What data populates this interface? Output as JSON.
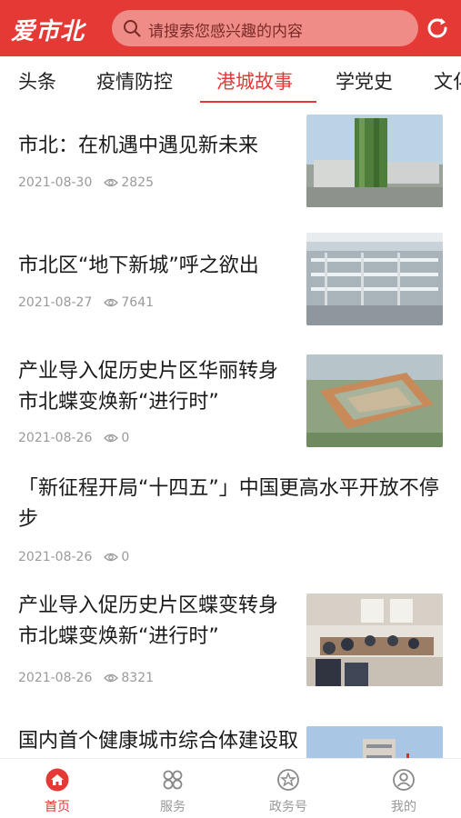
{
  "header": {
    "logo": "爱市北",
    "search_placeholder": "请搜索您感兴趣的内容",
    "brand_color": "#e53935"
  },
  "tabs": [
    {
      "label": "头条",
      "active": false
    },
    {
      "label": "疫情防控",
      "active": false
    },
    {
      "label": "港城故事",
      "active": true
    },
    {
      "label": "学党史",
      "active": false
    },
    {
      "label": "文化",
      "active": false
    }
  ],
  "articles": [
    {
      "title": "市北：在机遇中遇见新未来",
      "date": "2021-08-30",
      "views": "2825",
      "thumb": "green-tower-photo"
    },
    {
      "title": "市北区“地下新城”呼之欲出",
      "date": "2021-08-27",
      "views": "7641",
      "thumb": "underground-construction-photo"
    },
    {
      "title": "产业导入促历史片区华丽转身 市北蝶变焕新“进行时”",
      "date": "2021-08-26",
      "views": "0",
      "thumb": "courtyard-building-photo"
    },
    {
      "title": "「新征程开局“十四五”」中国更高水平开放不停步",
      "date": "2021-08-26",
      "views": "0",
      "thumb": ""
    },
    {
      "title": "产业导入促历史片区蝶变转身 市北蝶变焕新“进行时”",
      "date": "2021-08-26",
      "views": "8321",
      "thumb": "meeting-room-photo"
    },
    {
      "title": "国内首个健康城市综合体建设取得实质进展",
      "date": "",
      "views": "",
      "thumb": "highrise-construction-photo"
    }
  ],
  "bottom_nav": [
    {
      "label": "首页",
      "icon": "home-icon",
      "active": true
    },
    {
      "label": "服务",
      "icon": "services-icon",
      "active": false
    },
    {
      "label": "政务号",
      "icon": "gov-account-icon",
      "active": false
    },
    {
      "label": "我的",
      "icon": "profile-icon",
      "active": false
    }
  ]
}
